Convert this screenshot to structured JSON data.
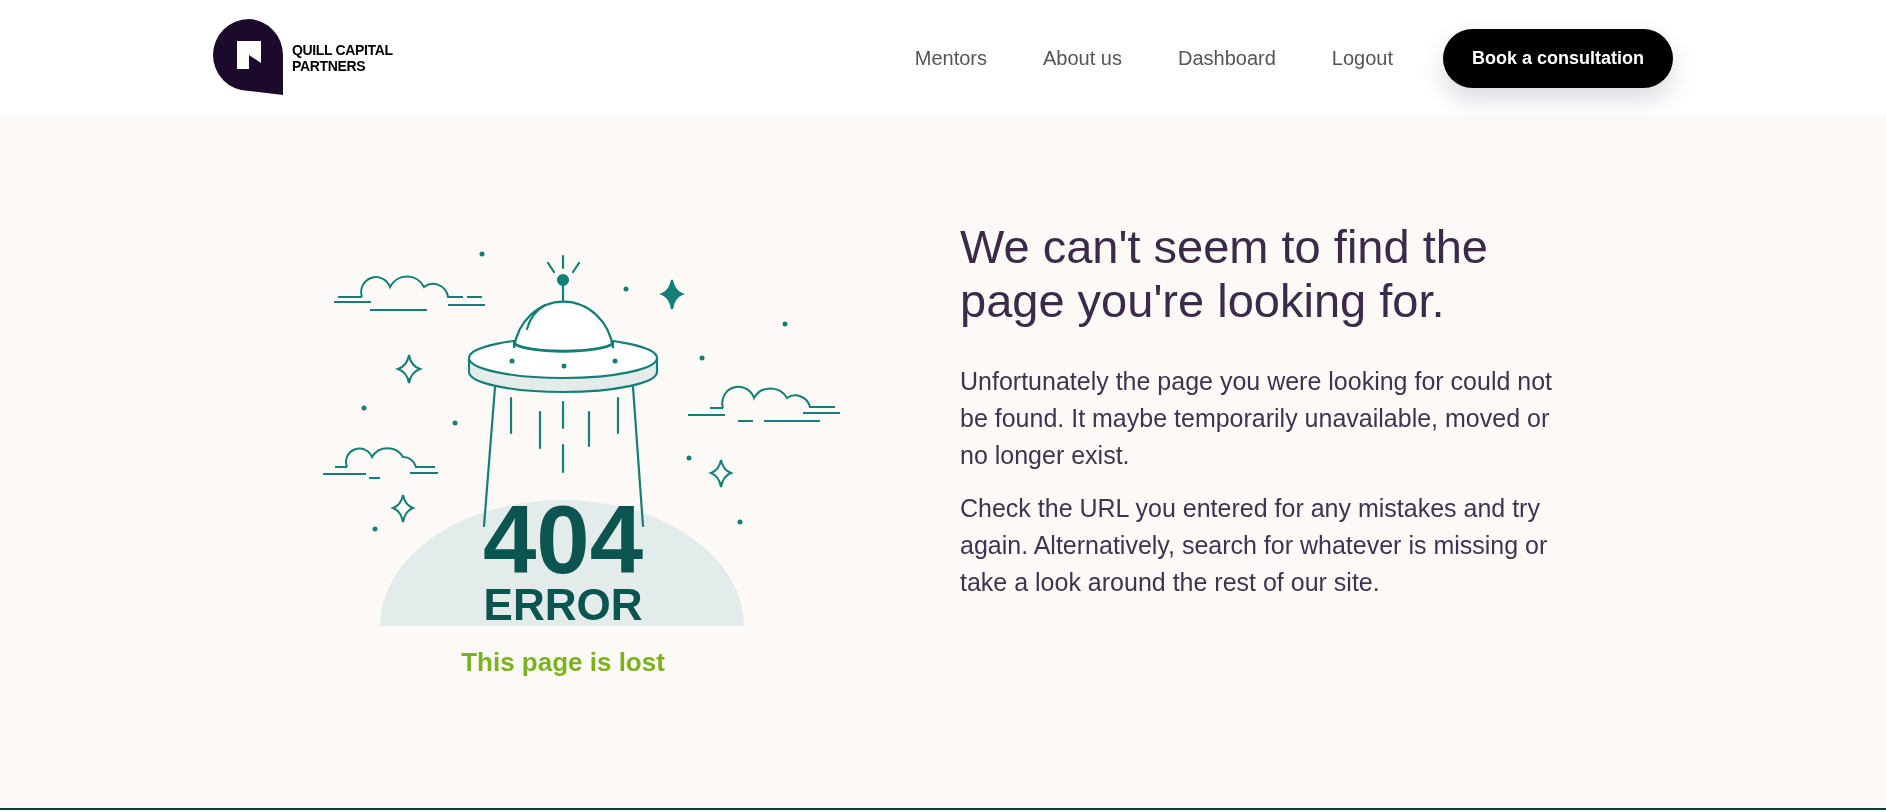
{
  "header": {
    "brand": "QUILL CAPITAL PARTNERS",
    "nav": [
      {
        "label": "Mentors"
      },
      {
        "label": "About us"
      },
      {
        "label": "Dashboard"
      },
      {
        "label": "Logout"
      }
    ],
    "cta": "Book a consultation"
  },
  "illustration": {
    "code": "404",
    "label": "ERROR",
    "caption": "This page is lost"
  },
  "heading": "We can't seem to find the page you're looking for.",
  "paragraphs": [
    "Unfortunately the page you were looking for could not be found. It maybe temporarily unavailable, moved or no longer exist.",
    "Check the URL you entered for any mistakes and try again. Alternatively, search for whatever is missing or take a look around the rest of our site."
  ]
}
